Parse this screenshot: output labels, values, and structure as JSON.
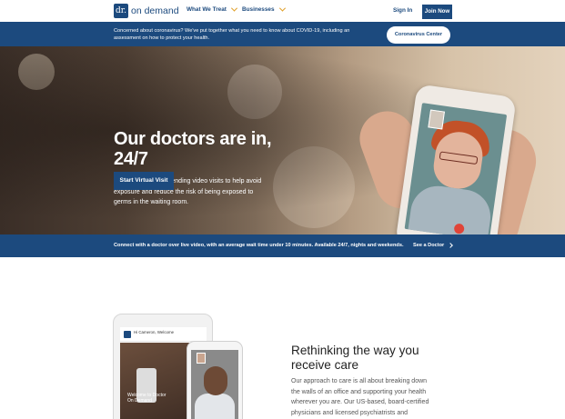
{
  "header": {
    "logo_badge": "dr.",
    "logo_text": "on demand",
    "nav": [
      {
        "label": "What We Treat"
      },
      {
        "label": "Businesses"
      }
    ],
    "signin_label": "Sign In",
    "join_label": "Join Now"
  },
  "covid_banner": {
    "text": "Concerned about coronavirus? We've put together what you need to know about COVID-19, including an assessment on how to protect your health.",
    "button_label": "Coronavirus Center"
  },
  "hero": {
    "title": "Our doctors are in, 24/7",
    "body": "The CDC is recommending video visits to help avoid exposure and reduce the risk of being exposed to germs in the waiting room.",
    "cta_label": "Start Virtual Visit"
  },
  "connect_strip": {
    "text": "Connect with a doctor over live video, with an average wait time under 10 minutes. Available 24/7, nights and weekends.",
    "link_label": "See a Doctor"
  },
  "devices": {
    "tablet_greeting": "Hi Cameron, Welcome",
    "tablet_welcome": "Welcome to Doctor On Demand"
  },
  "section": {
    "title": "Rethinking the way you receive care",
    "body": "Our approach to care is all about breaking down the walls of an office and supporting your health wherever you are. Our US-based, board-certified physicians and licensed psychiatrists and psychologists are available on your schedule"
  },
  "colors": {
    "brand": "#1c4a7e",
    "accent": "#e0a12c"
  }
}
